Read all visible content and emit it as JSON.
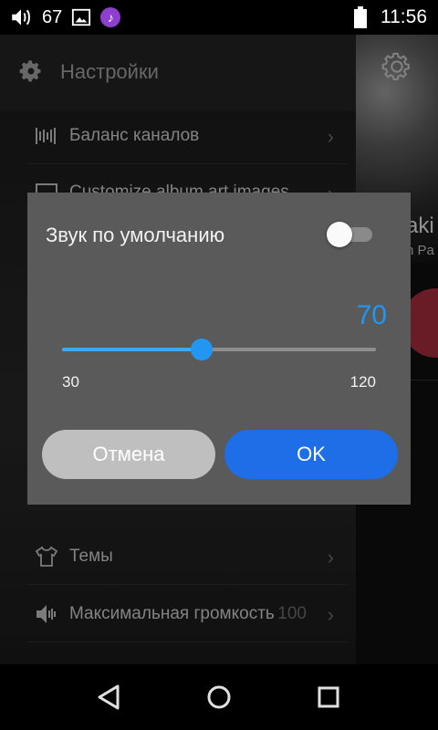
{
  "status_bar": {
    "volume_level": "67",
    "time": "11:56",
    "icons": [
      "volume-icon",
      "image-icon",
      "music-note-icon",
      "battery-icon"
    ]
  },
  "background": {
    "drawer": {
      "title": "Настройки",
      "items": [
        {
          "label": "Баланс каналов",
          "icon": "balance-icon"
        },
        {
          "label": "Customize album art images",
          "icon": "image-icon"
        },
        {
          "label": "Темы",
          "icon": "shirt-icon"
        },
        {
          "label": "Максимальная громкость",
          "icon": "volume-icon",
          "value": "100"
        }
      ]
    },
    "now_playing": {
      "title": "aki",
      "artist": "n Pa"
    }
  },
  "dialog": {
    "title": "Звук по умолчанию",
    "toggle_on": false,
    "slider": {
      "value": "70",
      "min": "30",
      "max": "120",
      "fraction": 0.4444
    },
    "cancel_label": "Отмена",
    "ok_label": "OK"
  },
  "colors": {
    "accent": "#2196f3",
    "ok_button": "#1e6ee8",
    "cancel_button": "#bfbfbf",
    "dialog_bg": "#5a5a5a"
  }
}
